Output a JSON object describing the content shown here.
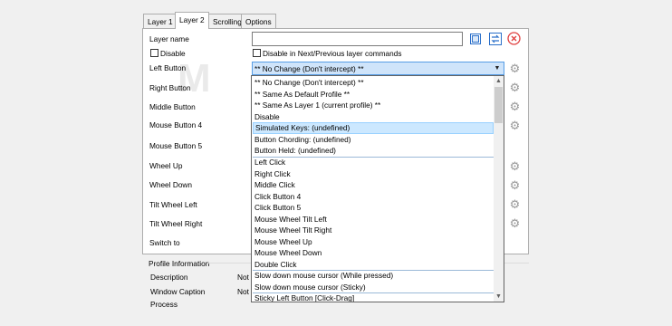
{
  "tabs": [
    {
      "label": "Layer 1",
      "active": false
    },
    {
      "label": "Layer 2",
      "active": true
    },
    {
      "label": "Scrolling",
      "active": false
    },
    {
      "label": "Options",
      "active": false
    }
  ],
  "layer_name": {
    "label": "Layer name",
    "value": ""
  },
  "disable_checkbox": {
    "label": "Disable",
    "checked": false
  },
  "disable_next_prev": {
    "label": "Disable in Next/Previous layer commands",
    "checked": false
  },
  "rows": [
    "Left Button",
    "Right Button",
    "Middle Button",
    "Mouse Button 4",
    "Mouse Button 5",
    "Wheel Up",
    "Wheel Down",
    "Tilt Wheel Left",
    "Tilt Wheel Right",
    "Switch to"
  ],
  "combo": {
    "selected": "** No Change (Don't intercept) **"
  },
  "dropdown_items": [
    "** No Change (Don't intercept) **",
    "** Same As Default Profile **",
    "** Same As Layer 1 (current profile) **",
    "Disable",
    "Simulated Keys: (undefined)",
    "Button Chording: (undefined)",
    "Button Held: (undefined)",
    "Left Click",
    "Right Click",
    "Middle Click",
    "Click Button 4",
    "Click Button 5",
    "Mouse Wheel Tilt Left",
    "Mouse Wheel Tilt Right",
    "Mouse Wheel Up",
    "Mouse Wheel Down",
    "Double Click",
    "Slow down mouse cursor (While pressed)",
    "Slow down mouse cursor (Sticky)",
    "Sticky Left Button [Click-Drag]"
  ],
  "dropdown_highlighted_index": 4,
  "profile_info": {
    "heading": "Profile Information",
    "description_label": "Description",
    "window_caption_label": "Window Caption",
    "process_label": "Process",
    "description_value": "Not s",
    "window_caption_value": "Not s"
  },
  "icons": {
    "copy": "copy-icon",
    "swap": "swap-icon",
    "clear": "clear-icon",
    "settings": "gear-icon"
  },
  "colors": {
    "selection": "#cce8ff",
    "combo_focus": "#cfe4fa",
    "clear_red": "#e04040",
    "swap_blue": "#2a6fc9"
  }
}
